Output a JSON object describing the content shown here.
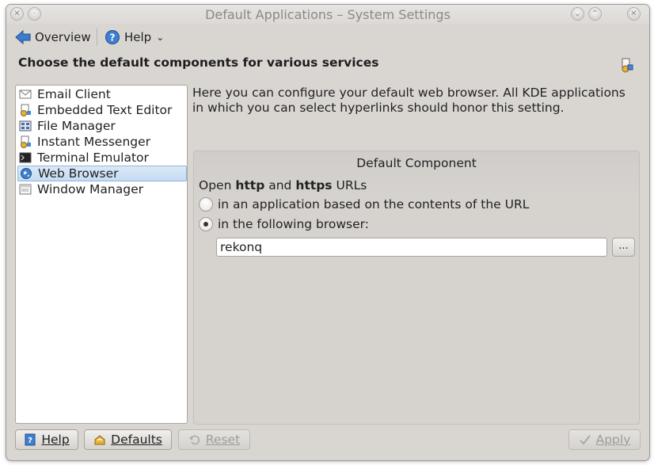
{
  "window": {
    "title": "Default Applications – System Settings"
  },
  "toolbar": {
    "overview_label": "Overview",
    "help_label": "Help"
  },
  "heading": "Choose the default components for various services",
  "components": [
    {
      "label": "Email Client",
      "icon": "email-icon"
    },
    {
      "label": "Embedded Text Editor",
      "icon": "text-editor-icon"
    },
    {
      "label": "File Manager",
      "icon": "file-manager-icon"
    },
    {
      "label": "Instant Messenger",
      "icon": "messenger-icon"
    },
    {
      "label": "Terminal Emulator",
      "icon": "terminal-icon"
    },
    {
      "label": "Web Browser",
      "icon": "globe-icon",
      "selected": true
    },
    {
      "label": "Window Manager",
      "icon": "window-icon"
    }
  ],
  "description": "Here you can configure your default web browser. All KDE applications in which you can select hyperlinks should honor this setting.",
  "group": {
    "title": "Default Component",
    "open_prefix": "Open",
    "open_http": "http",
    "open_and": "and",
    "open_https": "https",
    "open_suffix": "URLs",
    "radio_content": "in an application based on the contents of the URL",
    "radio_browser": "in the following browser:",
    "browser_value": "rekonq",
    "browse_label": "..."
  },
  "buttons": {
    "help": "Help",
    "defaults": "Defaults",
    "reset": "Reset",
    "apply": "Apply"
  },
  "colors": {
    "window_bg": "#d9d6d2",
    "selection": "#c5dcf3",
    "accent": "#2f6db5"
  }
}
